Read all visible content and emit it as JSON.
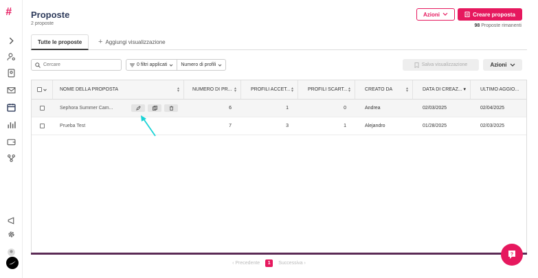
{
  "header": {
    "title": "Proposte",
    "subtitle": "2 proposte"
  },
  "actions_button": "Azioni",
  "create_button": "Creare proposta",
  "remaining": {
    "count": "98",
    "text": "Proposte rimanenti"
  },
  "tabs": {
    "active": "Tutte le proposte",
    "add": "Aggiungi visualizzazione"
  },
  "toolbar": {
    "search_placeholder": "Cercare",
    "filters": "0 filtri applicati",
    "profiles": "Numero di profili",
    "save_view": "Salva visualizzazione",
    "actions": "Azioni"
  },
  "table": {
    "headers": [
      "NOME DELLA PROPOSTA",
      "NUMERO DI PR...",
      "PROFILI ACCET...",
      "PROFILI SCART...",
      "CREATO DA",
      "DATA DI CREAZ...",
      "ULTIMO AGGIO..."
    ],
    "rows": [
      {
        "name": "Sephora Summer Cam...",
        "num": "6",
        "accepted": "1",
        "rejected": "0",
        "created_by": "Andrea",
        "created": "02/03/2025",
        "updated": "02/04/2025"
      },
      {
        "name": "Prueba Test",
        "num": "7",
        "accepted": "3",
        "rejected": "1",
        "created_by": "Alejandro",
        "created": "01/28/2025",
        "updated": "02/03/2025"
      }
    ]
  },
  "pagination": {
    "prev": "Precedente",
    "page": "1",
    "next": "Successiva"
  },
  "colors": {
    "accent": "#e6185e",
    "bar": "#5b2a55",
    "arrow": "#19d3d6"
  }
}
